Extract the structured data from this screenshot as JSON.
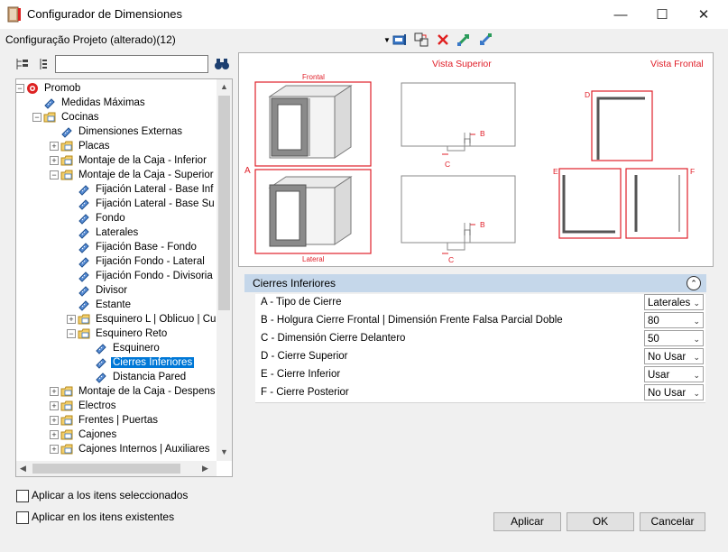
{
  "window": {
    "title": "Configurador de Dimensiones",
    "minimize": "—",
    "maximize": "☐",
    "close": "✕"
  },
  "toolbar": {
    "config_label": "Configuração Projeto (alterado)(12)"
  },
  "search": {
    "value": "",
    "placeholder": ""
  },
  "tree": {
    "items": [
      {
        "label": "Promob",
        "icon": "promob-logo-icon",
        "level": 0,
        "expander": "−"
      },
      {
        "label": "Medidas Máximas",
        "icon": "ruler-icon",
        "level": 1,
        "expander": ""
      },
      {
        "label": "Cocinas",
        "icon": "folder-icon",
        "level": 1,
        "expander": "−"
      },
      {
        "label": "Dimensiones Externas",
        "icon": "ruler-icon",
        "level": 2,
        "expander": ""
      },
      {
        "label": "Placas",
        "icon": "folder-icon",
        "level": 2,
        "expander": "+"
      },
      {
        "label": "Montaje de la Caja - Inferior",
        "icon": "folder-icon",
        "level": 2,
        "expander": "+"
      },
      {
        "label": "Montaje de la Caja - Superior",
        "icon": "folder-icon",
        "level": 2,
        "expander": "−"
      },
      {
        "label": "Fijación Lateral - Base Inf",
        "icon": "ruler-icon",
        "level": 3,
        "expander": ""
      },
      {
        "label": "Fijación Lateral - Base Su",
        "icon": "ruler-icon",
        "level": 3,
        "expander": ""
      },
      {
        "label": "Fondo",
        "icon": "ruler-icon",
        "level": 3,
        "expander": ""
      },
      {
        "label": "Laterales",
        "icon": "ruler-icon",
        "level": 3,
        "expander": ""
      },
      {
        "label": "Fijación Base - Fondo",
        "icon": "ruler-icon",
        "level": 3,
        "expander": ""
      },
      {
        "label": "Fijación Fondo - Lateral",
        "icon": "ruler-icon",
        "level": 3,
        "expander": ""
      },
      {
        "label": "Fijación Fondo - Divisoria",
        "icon": "ruler-icon",
        "level": 3,
        "expander": ""
      },
      {
        "label": "Divisor",
        "icon": "ruler-icon",
        "level": 3,
        "expander": ""
      },
      {
        "label": "Estante",
        "icon": "ruler-icon",
        "level": 3,
        "expander": ""
      },
      {
        "label": "Esquinero L | Oblicuo | Cu",
        "icon": "folder-icon",
        "level": 3,
        "expander": "+"
      },
      {
        "label": "Esquinero Reto",
        "icon": "folder-icon",
        "level": 3,
        "expander": "−"
      },
      {
        "label": "Esquinero",
        "icon": "ruler-icon",
        "level": 4,
        "expander": ""
      },
      {
        "label": "Cierres Inferiores",
        "icon": "ruler-icon",
        "level": 4,
        "expander": "",
        "selected": true
      },
      {
        "label": "Distancia Pared",
        "icon": "ruler-icon",
        "level": 4,
        "expander": ""
      },
      {
        "label": "Montaje de la Caja - Despens",
        "icon": "folder-icon",
        "level": 2,
        "expander": "+"
      },
      {
        "label": "Electros",
        "icon": "folder-icon",
        "level": 2,
        "expander": "+"
      },
      {
        "label": "Frentes | Puertas",
        "icon": "folder-icon",
        "level": 2,
        "expander": "+"
      },
      {
        "label": "Cajones",
        "icon": "folder-icon",
        "level": 2,
        "expander": "+"
      },
      {
        "label": "Cajones Internos | Auxiliares",
        "icon": "folder-icon",
        "level": 2,
        "expander": "+"
      }
    ]
  },
  "preview": {
    "vista_superior": "Vista Superior",
    "vista_frontal": "Vista Frontal",
    "frontal": "Frontal",
    "lateral": "Lateral",
    "A": "A",
    "B": "B",
    "C": "C",
    "D": "D",
    "E": "E",
    "F": "F",
    "accent": "#e0202a"
  },
  "properties": {
    "section_title": "Cierres Inferiores",
    "rows": [
      {
        "label": "A - Tipo de Cierre",
        "value": "Laterales"
      },
      {
        "label": "B - Holgura Cierre Frontal | Dimensión Frente Falsa Parcial Doble",
        "value": "80"
      },
      {
        "label": "C - Dimensión Cierre Delantero",
        "value": "50"
      },
      {
        "label": "D - Cierre Superior",
        "value": "No Usar"
      },
      {
        "label": "E - Cierre Inferior",
        "value": "Usar"
      },
      {
        "label": "F - Cierre Posterior",
        "value": "No Usar"
      }
    ]
  },
  "options": {
    "apply_selected": "Aplicar a los itens seleccionados",
    "apply_existing": "Aplicar en los itens existentes"
  },
  "buttons": {
    "apply": "Aplicar",
    "ok": "OK",
    "cancel": "Cancelar"
  }
}
